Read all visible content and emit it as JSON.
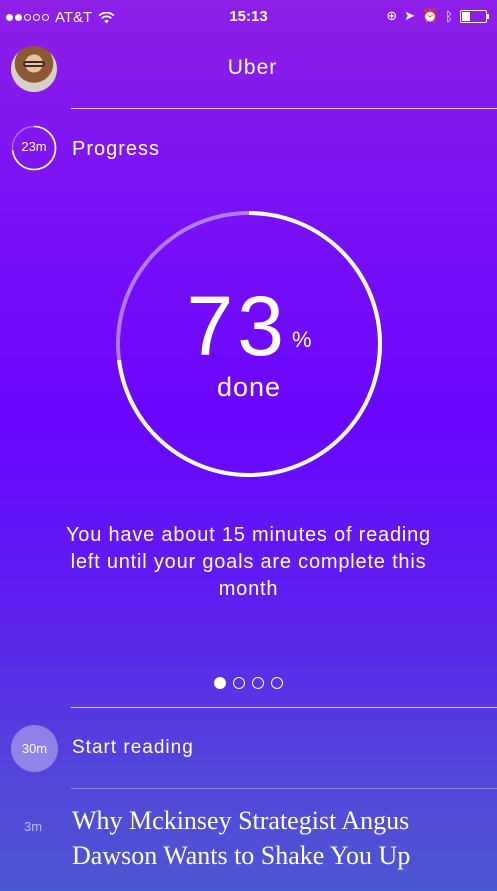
{
  "status_bar": {
    "carrier": "AT&T",
    "time": "15:13"
  },
  "header": {
    "title": "Uber"
  },
  "progress_row": {
    "time_label": "23m",
    "label": "Progress"
  },
  "progress": {
    "percent_value": "73",
    "percent_sign": "%",
    "done_label": "done",
    "fraction": 0.73
  },
  "message": "You have about 15 minutes of reading left until your goals are complete this month",
  "pager": {
    "pages": 4,
    "active": 0
  },
  "start_row": {
    "time_label": "30m",
    "label": "Start reading"
  },
  "article": {
    "time_label": "3m",
    "title": "Why Mckinsey Strategist Angus Dawson Wants to Shake You Up"
  },
  "colors": {
    "gradient_top": "#8e1fe6",
    "gradient_mid": "#6a06ff",
    "gradient_bottom": "#4d57d2"
  }
}
